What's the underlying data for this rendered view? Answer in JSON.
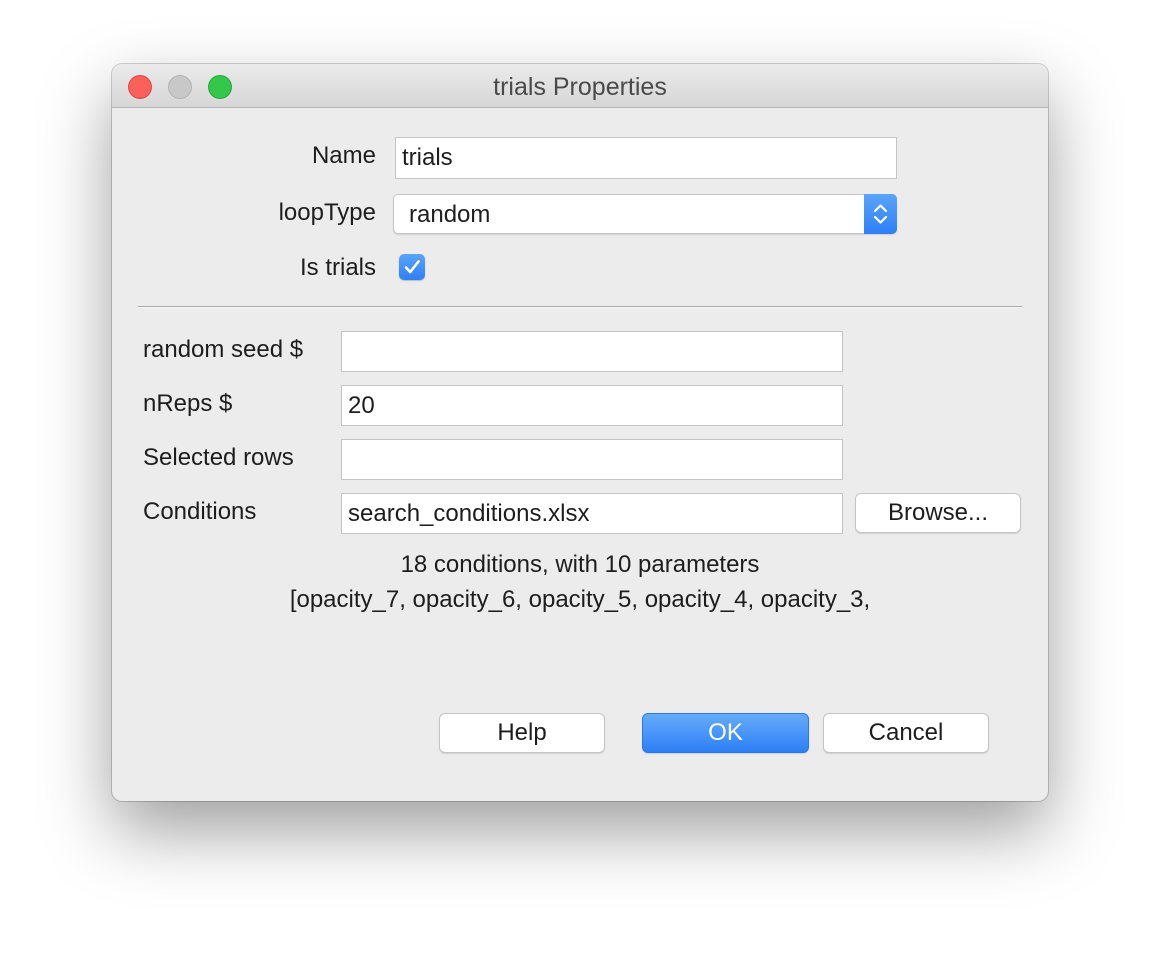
{
  "window": {
    "title": "trials Properties"
  },
  "basic": {
    "name_label": "Name",
    "name_value": "trials",
    "looptype_label": "loopType",
    "looptype_value": "random",
    "istrials_label": "Is trials",
    "istrials_checked": true
  },
  "advanced": {
    "random_seed_label": "random seed $",
    "random_seed_value": "",
    "nreps_label": "nReps $",
    "nreps_value": "20",
    "selected_rows_label": "Selected rows",
    "selected_rows_value": "",
    "conditions_label": "Conditions",
    "conditions_value": "search_conditions.xlsx",
    "browse_label": "Browse..."
  },
  "conditions_info": {
    "summary": "18 conditions, with 10 parameters",
    "parameters": "[opacity_7, opacity_6, opacity_5, opacity_4, opacity_3,"
  },
  "buttons": {
    "help": "Help",
    "ok": "OK",
    "cancel": "Cancel"
  },
  "colors": {
    "accent": "#2f7ff6",
    "close": "#fc605b",
    "minimize": "#c8c8c8",
    "zoom": "#34c84a"
  },
  "icons": {
    "checkbox": "checkmark-icon",
    "select": "up-down-chevron-icon"
  }
}
